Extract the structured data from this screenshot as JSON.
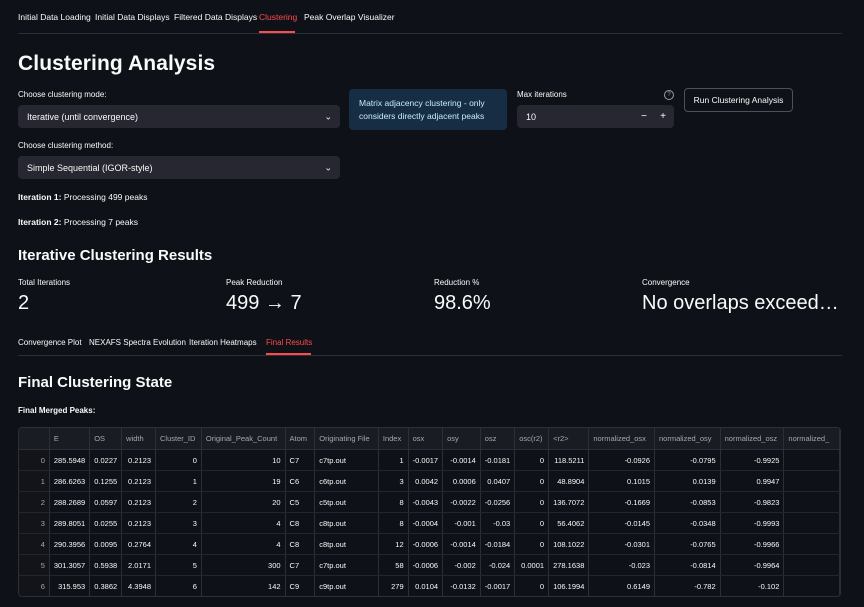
{
  "tabs": [
    {
      "label": "Initial Data Loading"
    },
    {
      "label": "Initial Data Displays"
    },
    {
      "label": "Filtered Data Displays"
    },
    {
      "label": "Clustering"
    },
    {
      "label": "Peak Overlap Visualizer"
    }
  ],
  "page_title": "Clustering Analysis",
  "clustering_mode": {
    "label": "Choose clustering mode:",
    "value": "Iterative (until convergence)"
  },
  "clustering_method": {
    "label": "Choose clustering method:",
    "value": "Simple Sequential (IGOR-style)"
  },
  "info_box": {
    "text": "Matrix adjacency clustering - only considers directly adjacent peaks"
  },
  "max_iterations": {
    "label": "Max iterations",
    "value": "10",
    "minus": "−",
    "plus": "+",
    "help": "?"
  },
  "run_button": {
    "label": "Run Clustering Analysis"
  },
  "iterations_log": [
    {
      "bold": "Iteration 1:",
      "text": " Processing 499 peaks"
    },
    {
      "bold": "Iteration 2:",
      "text": " Processing 7 peaks"
    }
  ],
  "results_heading": "Iterative Clustering Results",
  "metrics": [
    {
      "label": "Total Iterations",
      "value": "2"
    },
    {
      "label": "Peak Reduction",
      "value": "499 → 7"
    },
    {
      "label": "Reduction %",
      "value": "98.6%"
    },
    {
      "label": "Convergence",
      "value": "No overlaps exceed…"
    }
  ],
  "subtabs": [
    {
      "label": "Convergence Plot"
    },
    {
      "label": "NEXAFS Spectra Evolution"
    },
    {
      "label": "Iteration Heatmaps"
    },
    {
      "label": "Final Results"
    }
  ],
  "final_heading": "Final Clustering State",
  "final_subheading": "Final Merged Peaks:",
  "table": {
    "columns": [
      "",
      "E",
      "OS",
      "width",
      "Cluster_ID",
      "Original_Peak_Count",
      "Atom",
      "Originating File",
      "Index",
      "osx",
      "osy",
      "osz",
      "osc(r2)",
      "<r2>",
      "normalized_osx",
      "normalized_osy",
      "normalized_osz",
      "normalized_"
    ],
    "rows": [
      [
        "0",
        "285.5948",
        "0.0227",
        "0.2123",
        "0",
        "10",
        "C7",
        "c7tp.out",
        "1",
        "-0.0017",
        "-0.0014",
        "-0.0181",
        "0",
        "118.5211",
        "-0.0926",
        "-0.0795",
        "-0.9925",
        ""
      ],
      [
        "1",
        "286.6263",
        "0.1255",
        "0.2123",
        "1",
        "19",
        "C6",
        "c6tp.out",
        "3",
        "0.0042",
        "0.0006",
        "0.0407",
        "0",
        "48.8904",
        "0.1015",
        "0.0139",
        "0.9947",
        ""
      ],
      [
        "2",
        "288.2689",
        "0.0597",
        "0.2123",
        "2",
        "20",
        "C5",
        "c5tp.out",
        "8",
        "-0.0043",
        "-0.0022",
        "-0.0256",
        "0",
        "136.7072",
        "-0.1669",
        "-0.0853",
        "-0.9823",
        ""
      ],
      [
        "3",
        "289.8051",
        "0.0255",
        "0.2123",
        "3",
        "4",
        "C8",
        "c8tp.out",
        "8",
        "-0.0004",
        "-0.001",
        "-0.03",
        "0",
        "56.4062",
        "-0.0145",
        "-0.0348",
        "-0.9993",
        ""
      ],
      [
        "4",
        "290.3956",
        "0.0095",
        "0.2764",
        "4",
        "4",
        "C8",
        "c8tp.out",
        "12",
        "-0.0006",
        "-0.0014",
        "-0.0184",
        "0",
        "108.1022",
        "-0.0301",
        "-0.0765",
        "-0.9966",
        ""
      ],
      [
        "5",
        "301.3057",
        "0.5938",
        "2.0171",
        "5",
        "300",
        "C7",
        "c7tp.out",
        "58",
        "-0.0006",
        "-0.002",
        "-0.024",
        "0.0001",
        "278.1638",
        "-0.023",
        "-0.0814",
        "-0.9964",
        ""
      ],
      [
        "6",
        "315.953",
        "0.3862",
        "4.3948",
        "6",
        "142",
        "C9",
        "c9tp.out",
        "279",
        "0.0104",
        "-0.0132",
        "-0.0017",
        "0",
        "106.1994",
        "0.6149",
        "-0.782",
        "-0.102",
        ""
      ]
    ]
  },
  "colors": {
    "background": "#0e1117",
    "accent": "#ff4b4b",
    "info_bg": "#172d43",
    "input_bg": "#262730"
  }
}
